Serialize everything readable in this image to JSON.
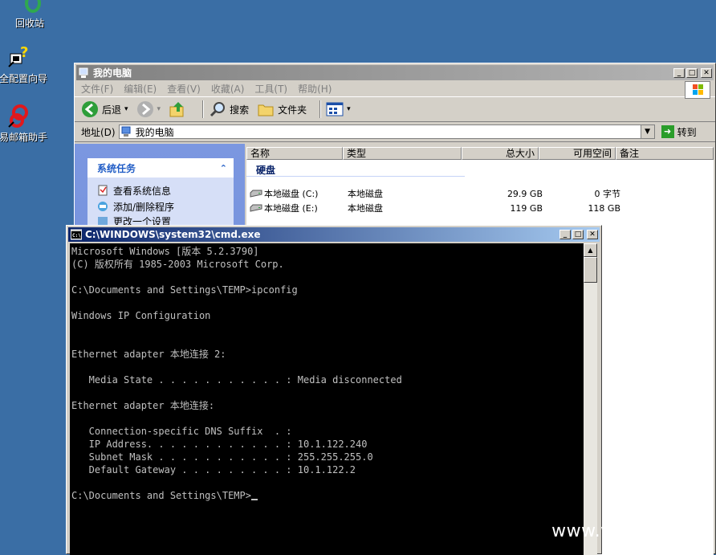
{
  "desktop": {
    "icons": [
      {
        "label": "回收站",
        "icon": "recycle-bin-icon"
      },
      {
        "label": "安全配置向导",
        "icon": "security-wizard-icon"
      },
      {
        "label": "网易邮箱助手",
        "icon": "mail-assistant-icon"
      }
    ]
  },
  "explorer": {
    "title": "我的电脑",
    "menu": [
      "文件(F)",
      "编辑(E)",
      "查看(V)",
      "收藏(A)",
      "工具(T)",
      "帮助(H)"
    ],
    "toolbar": {
      "back": "后退",
      "search": "搜索",
      "folders": "文件夹"
    },
    "address": {
      "label": "地址(D)",
      "value": "我的电脑",
      "go": "转到"
    },
    "tasks": {
      "title": "系统任务",
      "items": [
        "查看系统信息",
        "添加/删除程序",
        "更改一个设置"
      ]
    },
    "columns": [
      "名称",
      "类型",
      "总大小",
      "可用空间",
      "备注"
    ],
    "group": "硬盘",
    "drives": [
      {
        "name": "本地磁盘 (C:)",
        "type": "本地磁盘",
        "total": "29.9 GB",
        "free": "0 字节"
      },
      {
        "name": "本地磁盘 (E:)",
        "type": "本地磁盘",
        "total": "119 GB",
        "free": "118 GB"
      }
    ]
  },
  "cmd": {
    "title": "C:\\WINDOWS\\system32\\cmd.exe",
    "lines": [
      "Microsoft Windows [版本 5.2.3790]",
      "(C) 版权所有 1985-2003 Microsoft Corp.",
      "",
      "C:\\Documents and Settings\\TEMP>ipconfig",
      "",
      "Windows IP Configuration",
      "",
      "",
      "Ethernet adapter 本地连接 2:",
      "",
      "   Media State . . . . . . . . . . . : Media disconnected",
      "",
      "Ethernet adapter 本地连接:",
      "",
      "   Connection-specific DNS Suffix  . :",
      "   IP Address. . . . . . . . . . . . : 10.1.122.240",
      "   Subnet Mask . . . . . . . . . . . : 255.255.255.0",
      "   Default Gateway . . . . . . . . . : 10.1.122.2",
      "",
      "C:\\Documents and Settings\\TEMP>"
    ]
  },
  "watermark": "www.wooyun.org"
}
